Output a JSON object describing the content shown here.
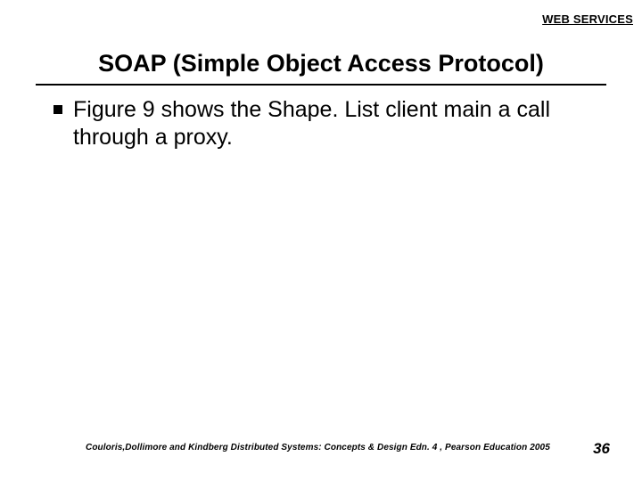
{
  "header": {
    "label": "WEB SERVICES"
  },
  "title": "SOAP (Simple Object Access Protocol)",
  "body": {
    "bullets": [
      {
        "text": "Figure 9 shows the Shape. List client main a call through a proxy."
      }
    ]
  },
  "footer": {
    "citation": "Couloris,Dollimore and Kindberg  Distributed Systems: Concepts & Design  Edn. 4 , Pearson Education 2005",
    "page": "36"
  }
}
